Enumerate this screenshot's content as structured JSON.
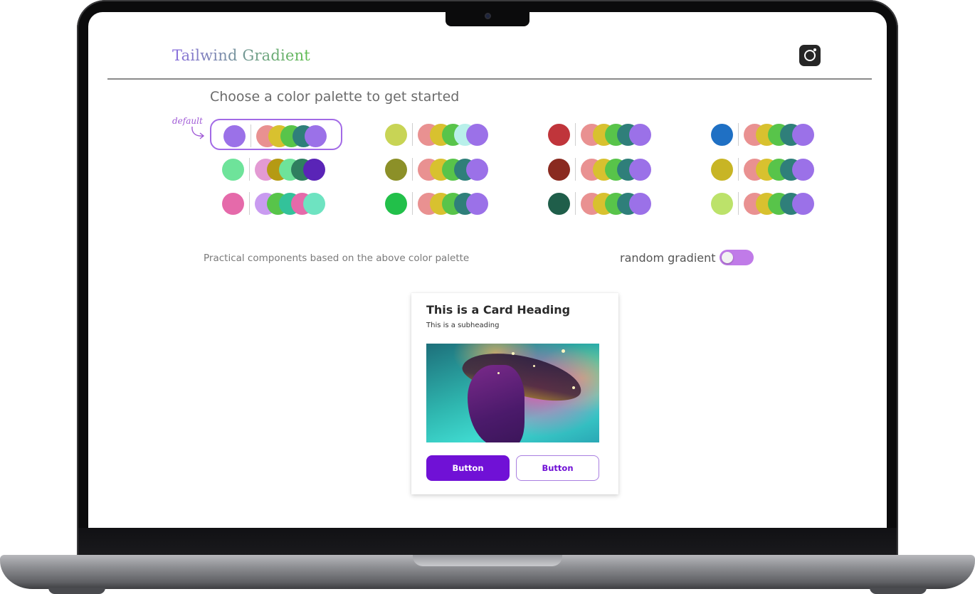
{
  "app": {
    "brand": "Tailwind Gradient",
    "heading": "Choose a color palette to get started",
    "default_note": "default",
    "practical_text": "Practical components based on the above color palette",
    "random_gradient_label": "random gradient",
    "random_gradient_on": true
  },
  "palettes": [
    {
      "main": "#9b71e8",
      "chips": [
        "#e99191",
        "#d8c12f",
        "#58c44a",
        "#2f7f7a",
        "#9b71e8"
      ],
      "selected": true
    },
    {
      "main": "#c8d455",
      "chips": [
        "#e99191",
        "#d8c12f",
        "#58c44a",
        "#b8f0ea",
        "#9b71e8"
      ]
    },
    {
      "main": "#c0353b",
      "chips": [
        "#e99191",
        "#d8c12f",
        "#58c44a",
        "#2f7f7a",
        "#9b71e8"
      ]
    },
    {
      "main": "#1f70c4",
      "chips": [
        "#e99191",
        "#d8c12f",
        "#58c44a",
        "#2f7f7a",
        "#9b71e8"
      ]
    },
    {
      "main": "#6ee39a",
      "chips": [
        "#e39ad3",
        "#b59a14",
        "#6ee39a",
        "#2f7f5f",
        "#5a24b7"
      ]
    },
    {
      "main": "#8c9028",
      "chips": [
        "#e99191",
        "#d8c12f",
        "#58c44a",
        "#2f7f7a",
        "#9b71e8"
      ]
    },
    {
      "main": "#8a2a20",
      "chips": [
        "#e99191",
        "#d8c12f",
        "#58c44a",
        "#2f7f7a",
        "#9b71e8"
      ]
    },
    {
      "main": "#c8b525",
      "chips": [
        "#e99191",
        "#d8c12f",
        "#58c44a",
        "#2f7f7a",
        "#9b71e8"
      ]
    },
    {
      "main": "#e56aaa",
      "chips": [
        "#c99bf0",
        "#58c44a",
        "#33c29a",
        "#e56aaa",
        "#6ee3c1"
      ]
    },
    {
      "main": "#22c04a",
      "chips": [
        "#e99191",
        "#d8c12f",
        "#58c44a",
        "#2f7f7a",
        "#9b71e8"
      ]
    },
    {
      "main": "#1f5e4a",
      "chips": [
        "#e99191",
        "#d8c12f",
        "#58c44a",
        "#2f7f7a",
        "#9b71e8"
      ]
    },
    {
      "main": "#bce26a",
      "chips": [
        "#e99191",
        "#d8c12f",
        "#58c44a",
        "#2f7f7a",
        "#9b71e8"
      ]
    }
  ],
  "card": {
    "title": "This is a Card Heading",
    "subtitle": "This is a subheading",
    "primary_button": "Button",
    "secondary_button": "Button"
  },
  "colors": {
    "accent": "#7011d6",
    "toggle": "#c07be8",
    "selected_border": "#a26ae6"
  }
}
